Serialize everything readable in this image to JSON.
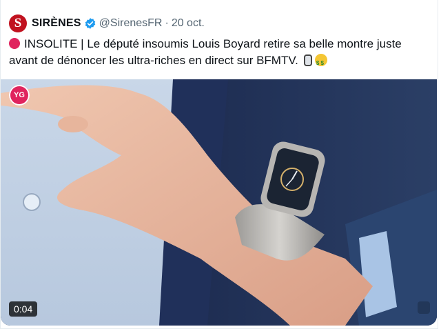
{
  "tweet": {
    "account": {
      "avatar_letter": "S",
      "name": "SIRÈNES",
      "handle": "@SirenesFR",
      "separator": "·",
      "date": "20 oct.",
      "verified": true
    },
    "text_lines": [
      "INSOLITE | Le député insoumis Louis Boyard retire sa belle montre juste",
      "avant de dénoncer les ultra-riches en direct sur BFMTV."
    ],
    "emojis": [
      "watch-emoji",
      "money-mouth-face-emoji",
      "red-circle-emoji"
    ]
  },
  "media": {
    "badge": "YG",
    "timecode": "0:04",
    "type": "video"
  },
  "colors": {
    "brand": "#c1121f",
    "verified": "#1d9bf0",
    "muted_text": "#536471",
    "red_dot": "#e0245e"
  }
}
